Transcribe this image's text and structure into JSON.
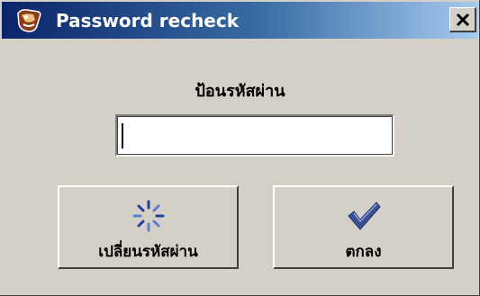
{
  "window": {
    "title": "Password recheck"
  },
  "dialog": {
    "prompt": "ป้อนรหัสผ่าน",
    "password_value": ""
  },
  "buttons": {
    "change_password_label": "เปลี่ยนรหัสผ่าน",
    "ok_label": "ตกลง"
  },
  "icons": {
    "app": "app-icon",
    "close": "close-icon",
    "change_password": "spinner-icon",
    "ok": "checkmark-icon"
  },
  "colors": {
    "titlebar_start": "#0a246a",
    "titlebar_end": "#a6caf0",
    "dialog_bg": "#d4d0c8",
    "checkmark": "#3c4f8f"
  }
}
